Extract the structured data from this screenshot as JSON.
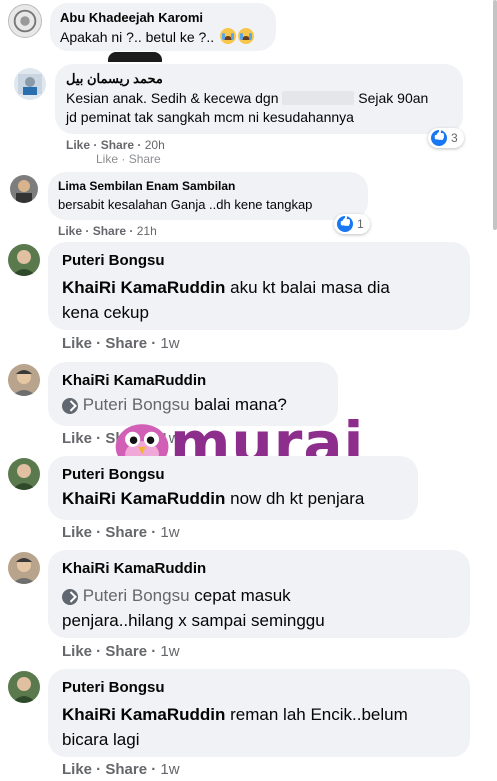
{
  "comments": [
    {
      "author": "Abu Khadeejah Karomi",
      "text": "Apakah ni ?.. betul ke ?..",
      "emoji": [
        "crying-face",
        "crying-face"
      ]
    },
    {
      "author": "محمد ريسمان بيل",
      "text_before": "Kesian anak. Sedih & kecewa dgn",
      "text_after": "Sejak 90an",
      "text_line2": "jd peminat tak sangkah mcm ni kesudahannya",
      "like_label": "Like",
      "share_label": "Share",
      "time": "20h",
      "reaction_count": "3"
    },
    {
      "author": "Lima Sembilan Enam Sambilan",
      "text": "bersabit kesalahan Ganja ..dh kene tangkap",
      "like_label": "Like",
      "share_label": "Share",
      "time": "21h",
      "reaction_count": "1"
    },
    {
      "author": "Puteri Bongsu",
      "mention": "KhaiRi KamaRuddin",
      "text_line1": "aku kt balai masa dia",
      "text_line2": "kena cekup",
      "like_label": "Like",
      "share_label": "Share",
      "time": "1w"
    },
    {
      "author": "KhaiRi KamaRuddin",
      "mention": "Puteri Bongsu",
      "text": "balai mana?",
      "like_label": "Like",
      "share_label": "Share",
      "time": "1w"
    },
    {
      "author": "Puteri Bongsu",
      "mention": "KhaiRi KamaRuddin",
      "text": "now dh kt penjara",
      "like_label": "Like",
      "share_label": "Share",
      "time": "1w"
    },
    {
      "author": "KhaiRi KamaRuddin",
      "mention": "Puteri Bongsu",
      "text_line1": "cepat masuk",
      "text_line2": "penjara..hilang x sampai seminggu",
      "like_label": "Like",
      "share_label": "Share",
      "time": "1w"
    },
    {
      "author": "Puteri Bongsu",
      "mention": "KhaiRi KamaRuddin",
      "text_line1": "reman lah Encik..belum",
      "text_line2": "bicara lagi",
      "like_label": "Like",
      "share_label": "Share",
      "time": "1w"
    }
  ],
  "cut_row": {
    "like_label": "Like",
    "share_label": "Share"
  },
  "watermark": "murai",
  "colors": {
    "bubble": "#f0f2f5",
    "meta": "#65676b",
    "reaction_blue": "#1877f2",
    "watermark": "#8e2e8c"
  }
}
